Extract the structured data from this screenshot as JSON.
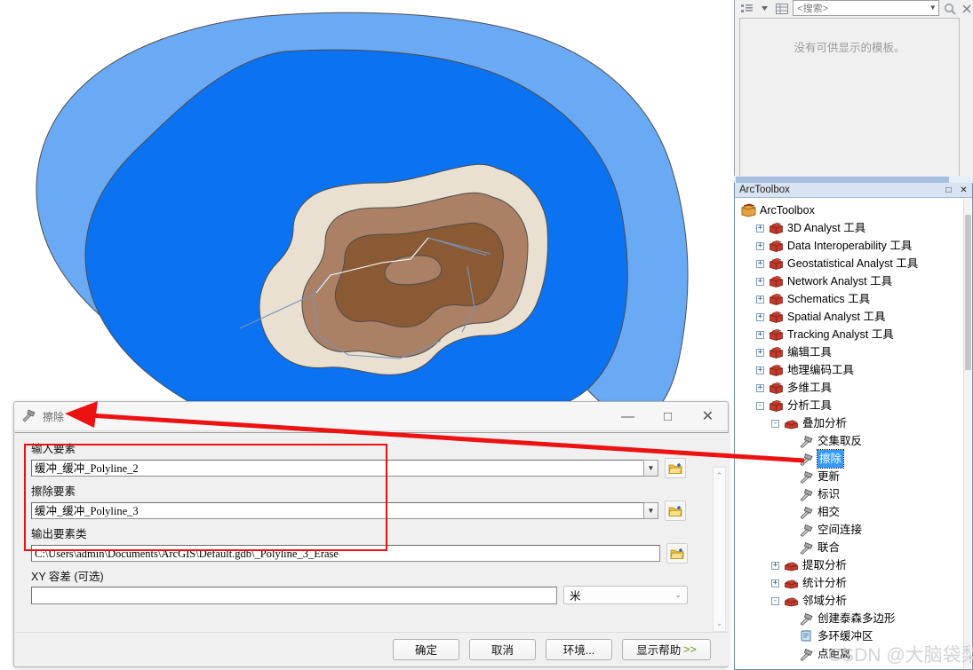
{
  "create_features_panel": {
    "search_placeholder": "<搜索>",
    "empty_message": "没有可供显示的模板。",
    "icons": [
      "list-view-icon",
      "grid-view-icon",
      "magnifier-icon",
      "close-icon"
    ]
  },
  "arctoolbox": {
    "title": "ArcToolbox",
    "root_label": "ArcToolbox",
    "tree": [
      {
        "label": "3D Analyst 工具",
        "indent": 1,
        "expander": "+",
        "icon": "toolbox-icon"
      },
      {
        "label": "Data Interoperability 工具",
        "indent": 1,
        "expander": "+",
        "icon": "toolbox-icon"
      },
      {
        "label": "Geostatistical Analyst 工具",
        "indent": 1,
        "expander": "+",
        "icon": "toolbox-icon"
      },
      {
        "label": "Network Analyst 工具",
        "indent": 1,
        "expander": "+",
        "icon": "toolbox-icon"
      },
      {
        "label": "Schematics 工具",
        "indent": 1,
        "expander": "+",
        "icon": "toolbox-icon"
      },
      {
        "label": "Spatial Analyst 工具",
        "indent": 1,
        "expander": "+",
        "icon": "toolbox-icon"
      },
      {
        "label": "Tracking Analyst 工具",
        "indent": 1,
        "expander": "+",
        "icon": "toolbox-icon"
      },
      {
        "label": "编辑工具",
        "indent": 1,
        "expander": "+",
        "icon": "toolbox-icon"
      },
      {
        "label": "地理编码工具",
        "indent": 1,
        "expander": "+",
        "icon": "toolbox-icon"
      },
      {
        "label": "多维工具",
        "indent": 1,
        "expander": "+",
        "icon": "toolbox-icon"
      },
      {
        "label": "分析工具",
        "indent": 1,
        "expander": "-",
        "icon": "toolbox-icon"
      },
      {
        "label": "叠加分析",
        "indent": 2,
        "expander": "-",
        "icon": "toolset-icon"
      },
      {
        "label": "交集取反",
        "indent": 3,
        "expander": "",
        "icon": "tool-hammer-icon"
      },
      {
        "label": "擦除",
        "indent": 3,
        "expander": "",
        "icon": "tool-hammer-icon",
        "selected": true
      },
      {
        "label": "更新",
        "indent": 3,
        "expander": "",
        "icon": "tool-hammer-icon"
      },
      {
        "label": "标识",
        "indent": 3,
        "expander": "",
        "icon": "tool-hammer-icon"
      },
      {
        "label": "相交",
        "indent": 3,
        "expander": "",
        "icon": "tool-hammer-icon"
      },
      {
        "label": "空间连接",
        "indent": 3,
        "expander": "",
        "icon": "tool-hammer-icon"
      },
      {
        "label": "联合",
        "indent": 3,
        "expander": "",
        "icon": "tool-hammer-icon"
      },
      {
        "label": "提取分析",
        "indent": 2,
        "expander": "+",
        "icon": "toolset-icon"
      },
      {
        "label": "统计分析",
        "indent": 2,
        "expander": "+",
        "icon": "toolset-icon"
      },
      {
        "label": "邻域分析",
        "indent": 2,
        "expander": "-",
        "icon": "toolset-icon"
      },
      {
        "label": "创建泰森多边形",
        "indent": 3,
        "expander": "",
        "icon": "tool-hammer-icon"
      },
      {
        "label": "多环缓冲区",
        "indent": 3,
        "expander": "",
        "icon": "tool-script-icon"
      },
      {
        "label": "点距离",
        "indent": 3,
        "expander": "",
        "icon": "tool-hammer-icon"
      }
    ],
    "window_controls": {
      "maximize": "□",
      "close": "✕"
    }
  },
  "watermark": "CSDN @大脑袋梨",
  "erase_dialog": {
    "title": "擦除",
    "icon": "tool-hammer-icon",
    "window_controls": {
      "minimize": "—",
      "maximize": "□",
      "close": "✕"
    },
    "fields": [
      {
        "label": "输入要素",
        "value": "缓冲_缓冲_Polyline_2",
        "kind": "combo",
        "browse_icon": "open-folder-icon"
      },
      {
        "label": "擦除要素",
        "value": "缓冲_缓冲_Polyline_3",
        "kind": "combo",
        "browse_icon": "open-folder-icon"
      },
      {
        "label": "输出要素类",
        "value": "C:\\Users\\admin\\Documents\\ArcGIS\\Default.gdb\\_Polyline_3_Erase",
        "kind": "text",
        "browse_icon": "open-folder-icon"
      }
    ],
    "xy_tolerance": {
      "label": "XY 容差 (可选)",
      "value": "",
      "unit": "米"
    },
    "buttons": [
      {
        "label": "确定",
        "name": "ok-button"
      },
      {
        "label": "取消",
        "name": "cancel-button"
      },
      {
        "label": "环境...",
        "name": "environments-button"
      },
      {
        "label": "显示帮助 ",
        "suffix": ">>",
        "name": "show-help-button"
      }
    ]
  },
  "map": {
    "layers": [
      {
        "name": "outer-buffer-ring",
        "color": "#6aaaf5"
      },
      {
        "name": "mid-buffer-ring",
        "color": "#0b72f2"
      },
      {
        "name": "inner-cream-ring",
        "color": "#e9e0d1"
      },
      {
        "name": "tan-buffer-ring",
        "color": "#ab8064"
      },
      {
        "name": "core-brown-buffer",
        "color": "#8a5a34"
      },
      {
        "name": "polyline-feature",
        "color": "#7a93b8"
      }
    ]
  },
  "annotation": {
    "highlight_color": "#ee1111",
    "arrow_from": "toolbox-erase-item",
    "arrow_to": "erase-dialog-title"
  }
}
